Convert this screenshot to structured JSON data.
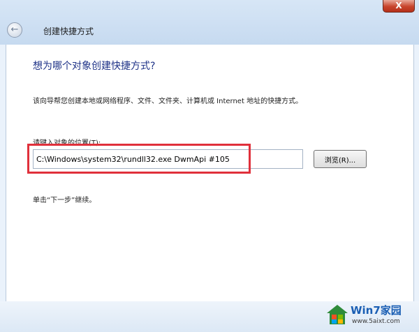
{
  "window": {
    "title": "创建快捷方式",
    "close_label": "X"
  },
  "wizard": {
    "heading": "想为哪个对象创建快捷方式?",
    "description": "该向导帮您创建本地或网络程序、文件、文件夹、计算机或 Internet 地址的快捷方式。",
    "location_label": "请键入对象的位置(T):",
    "location_value": "C:\\Windows\\system32\\rundll32.exe DwmApi #105",
    "browse_label": "浏览(R)...",
    "next_hint": "单击“下一步”继续。"
  },
  "watermark": {
    "title": "Win7家园",
    "url": "www.5aixt.com"
  },
  "colors": {
    "heading": "#1e3287",
    "highlight": "#e0303b",
    "titlebar": "#c6daf0"
  }
}
